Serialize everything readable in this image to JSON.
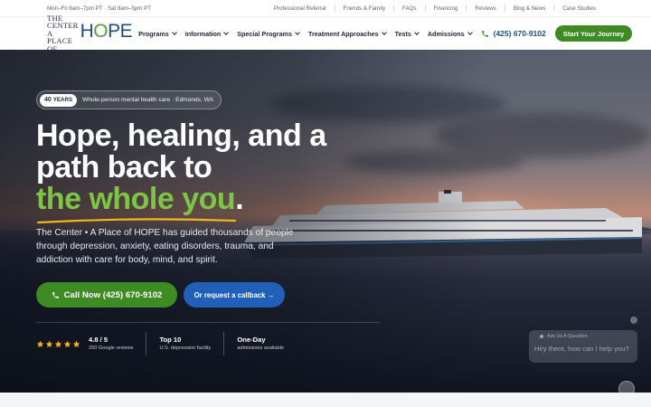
{
  "utility": {
    "hours": "Mon–Fri 8am–7pm PT · Sat 8am–5pm PT",
    "links": [
      "Professional Referral",
      "Friends & Family",
      "FAQs",
      "Financing",
      "Reviews",
      "Blog & News",
      "Case Studies"
    ]
  },
  "logo": {
    "line1": "THE CENTER",
    "line2": "A PLACE OF",
    "word_h": "H",
    "word_o": "O",
    "word_pe": "PE"
  },
  "nav": {
    "items": [
      "Programs",
      "Information",
      "Special Programs",
      "Treatment Approaches",
      "Tests",
      "Admissions"
    ],
    "phone": "(425) 670-9102",
    "cta": "Start Your Journey"
  },
  "hero": {
    "badge_num": "40",
    "badge_unit": "YEARS",
    "badge_text": "Whole-person mental health care · Edmonds, WA",
    "headline_line1": "Hope, healing, and a",
    "headline_line2": "path back to",
    "headline_highlight": "the whole you",
    "headline_period": ".",
    "intro": "The Center • A Place of HOPE has guided thousands of people through depression, anxiety, eating disorders, trauma, and addiction with care for body, mind, and spirit.",
    "call_label": "Call Now (425) 670-9102",
    "callback_label": "Or request a callback →"
  },
  "stats": [
    {
      "big": "4.8 / 5",
      "small": "250 Google reviews",
      "stars": 5
    },
    {
      "big": "Top 10",
      "small": "U.S. depression facility"
    },
    {
      "big": "One-Day",
      "small": "admissions available"
    }
  ],
  "chat": {
    "question_label": "Ask Us A Question",
    "message": "Hiry there, how can I help you?"
  },
  "colors": {
    "brand_green": "#3e8a23",
    "highlight_green": "#7ec445",
    "brand_blue": "#1f4f7a",
    "callback_blue": "#2060b8",
    "star_gold": "#f5b81c"
  }
}
